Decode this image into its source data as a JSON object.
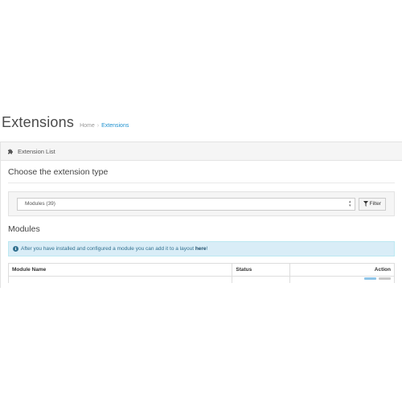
{
  "header": {
    "title": "Extensions",
    "breadcrumb": [
      {
        "label": "Home",
        "active": false
      },
      {
        "label": "Extensions",
        "active": true
      }
    ],
    "separator": "›"
  },
  "panel": {
    "heading": "Extension List",
    "heading_icon": "puzzle-icon"
  },
  "extension_type": {
    "title": "Choose the extension type",
    "select_value": "Modules (39)",
    "filter_label": "Filter",
    "filter_icon": "funnel-icon"
  },
  "modules": {
    "title": "Modules",
    "alert_text_before": "After you have installed and configured a module you can add it to a layout ",
    "alert_link": "here",
    "alert_text_after": "!",
    "alert_icon": "info-icon"
  },
  "table": {
    "columns": [
      "Module Name",
      "Status",
      "Action"
    ]
  },
  "colors": {
    "accent": "#1e91cf",
    "alert_bg": "#d9edf7",
    "alert_text": "#31708f"
  }
}
